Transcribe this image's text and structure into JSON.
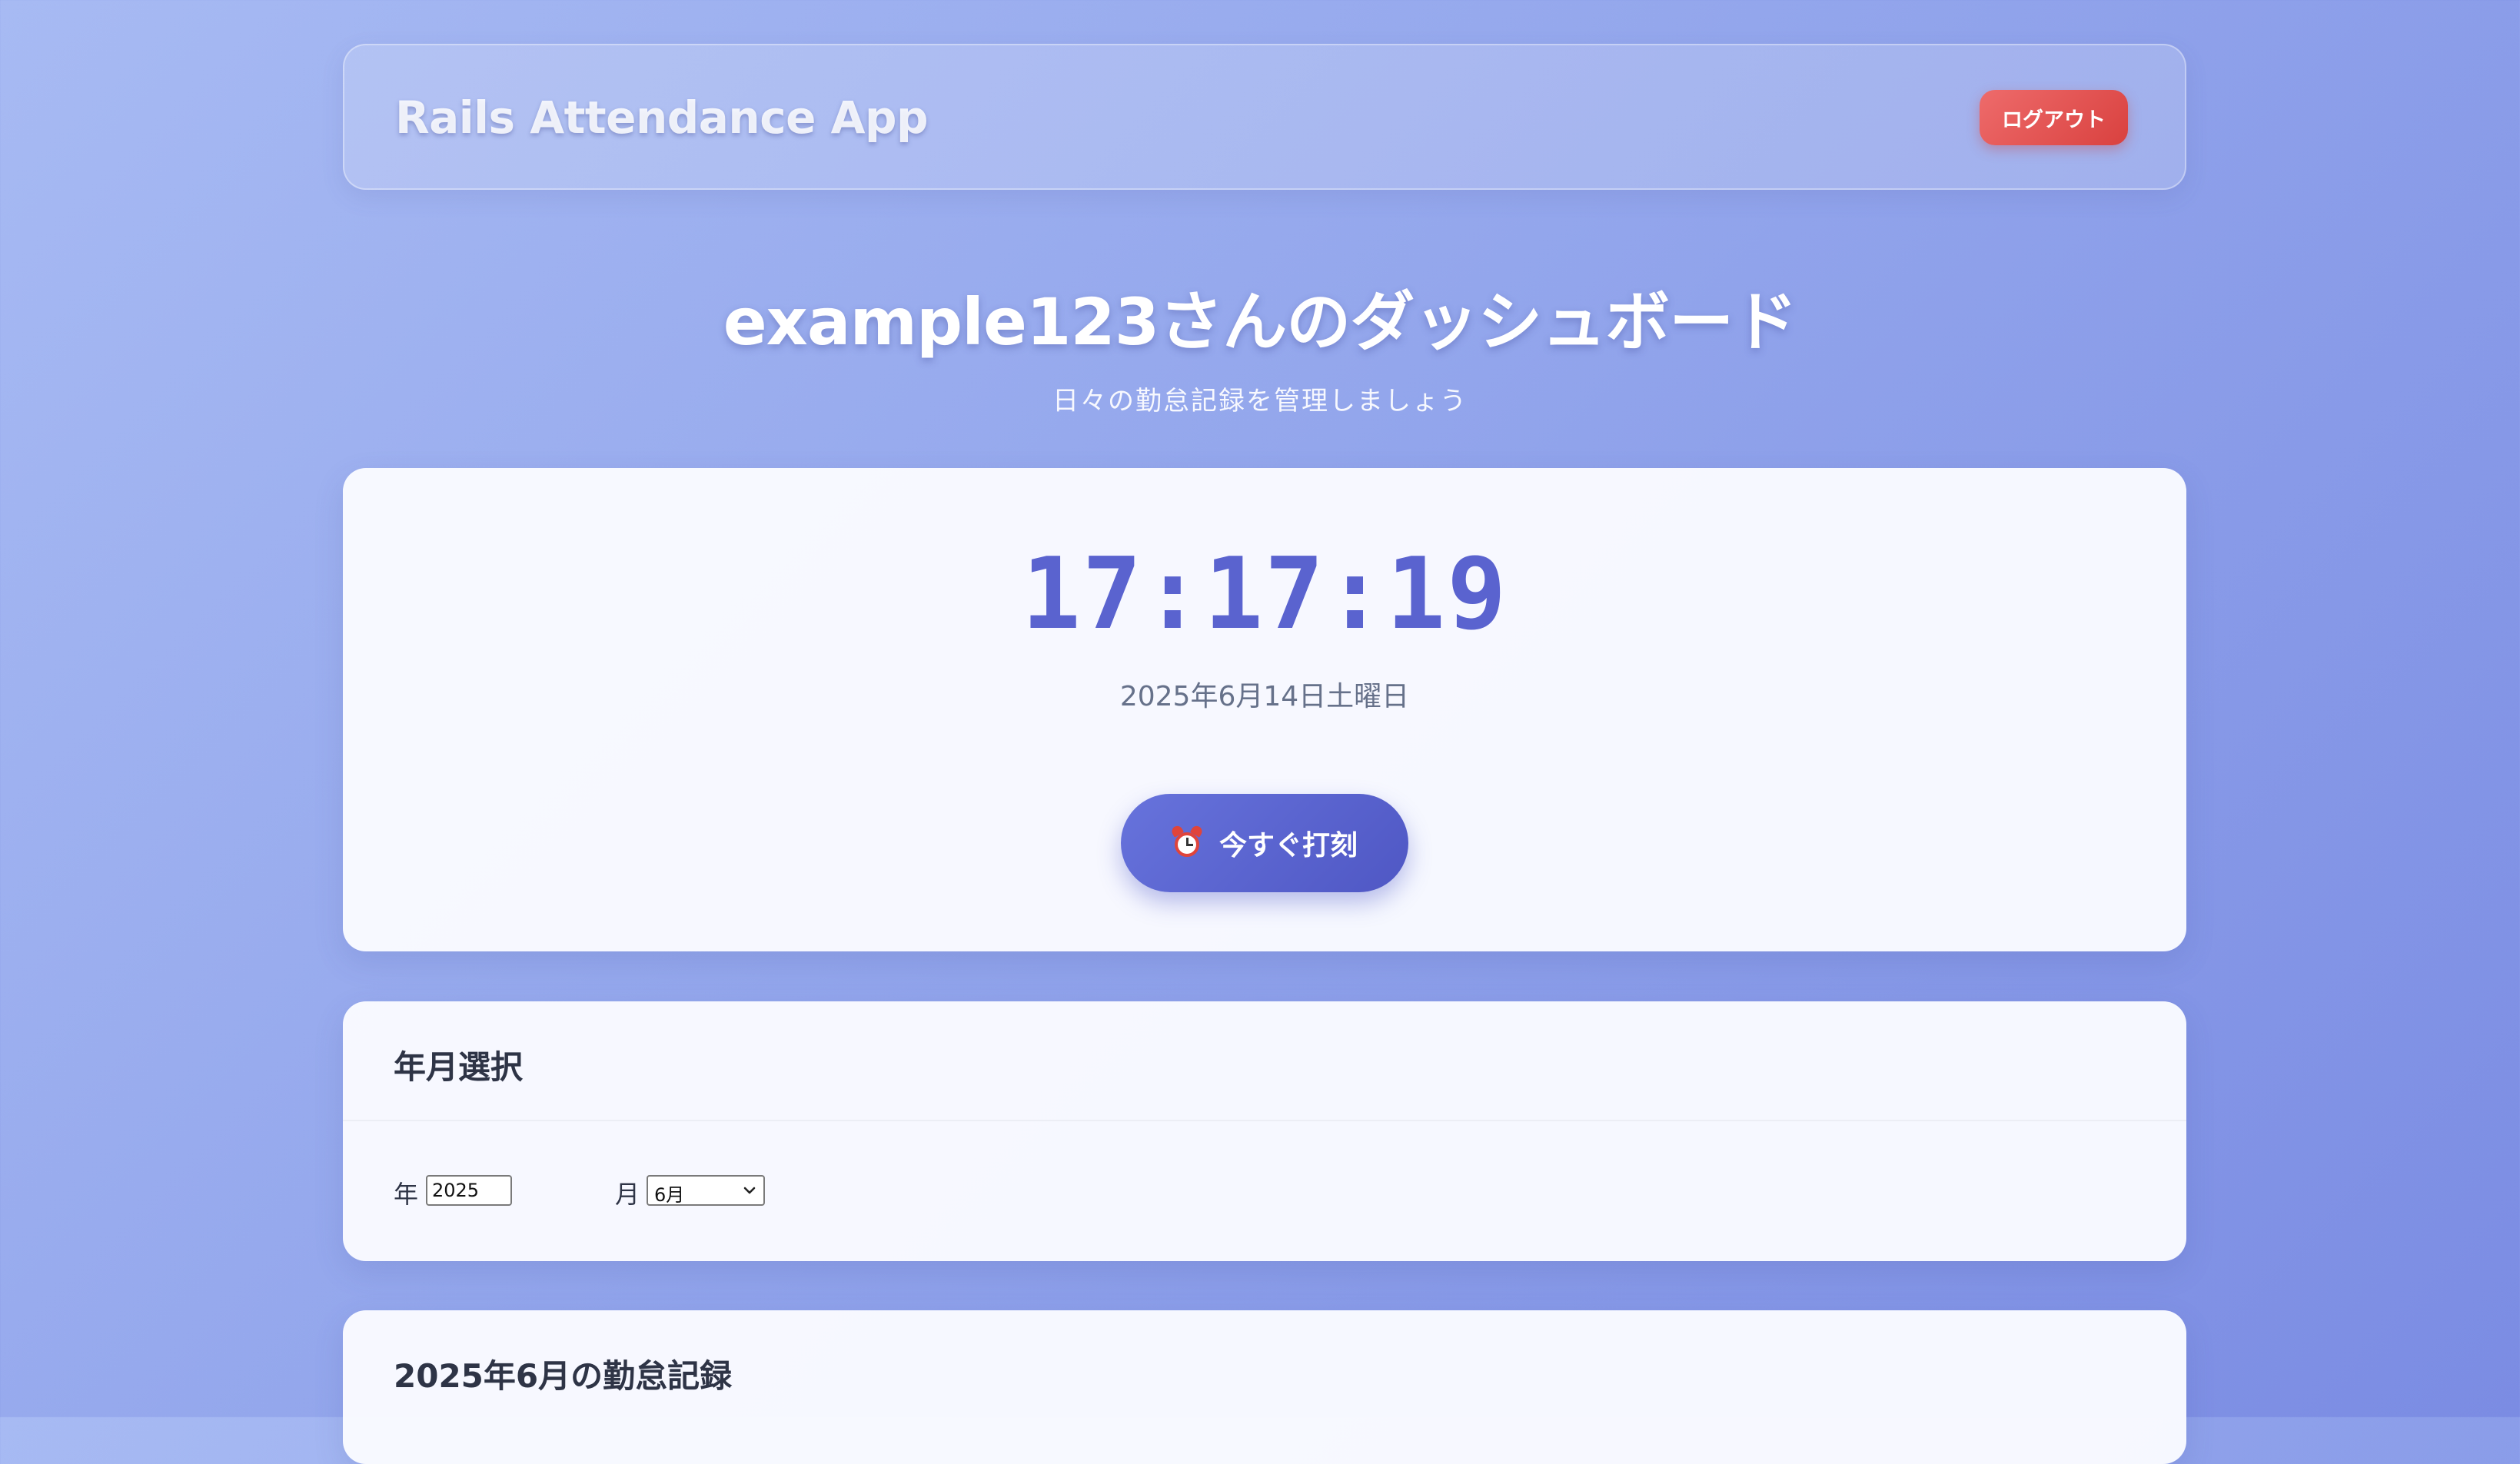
{
  "header": {
    "app_name": "Rails Attendance App",
    "logout_label": "ログアウト"
  },
  "page": {
    "title": "example123さんのダッシュボード",
    "subtitle": "日々の勤怠記録を管理しましょう"
  },
  "clock": {
    "time": "17:17:19",
    "date": "2025年6月14日土曜日",
    "punch_label": "今すぐ打刻",
    "punch_icon": "alarm-clock-icon"
  },
  "year_month": {
    "title": "年月選択",
    "year_label": "年",
    "year_value": "2025",
    "month_label": "月",
    "month_value": "6月"
  },
  "records": {
    "title": "2025年6月の勤怠記録"
  },
  "colors": {
    "accent": "#5a63cf",
    "logout": "#e05252",
    "background_start": "#a7baf3",
    "background_end": "#7b8ce3"
  }
}
